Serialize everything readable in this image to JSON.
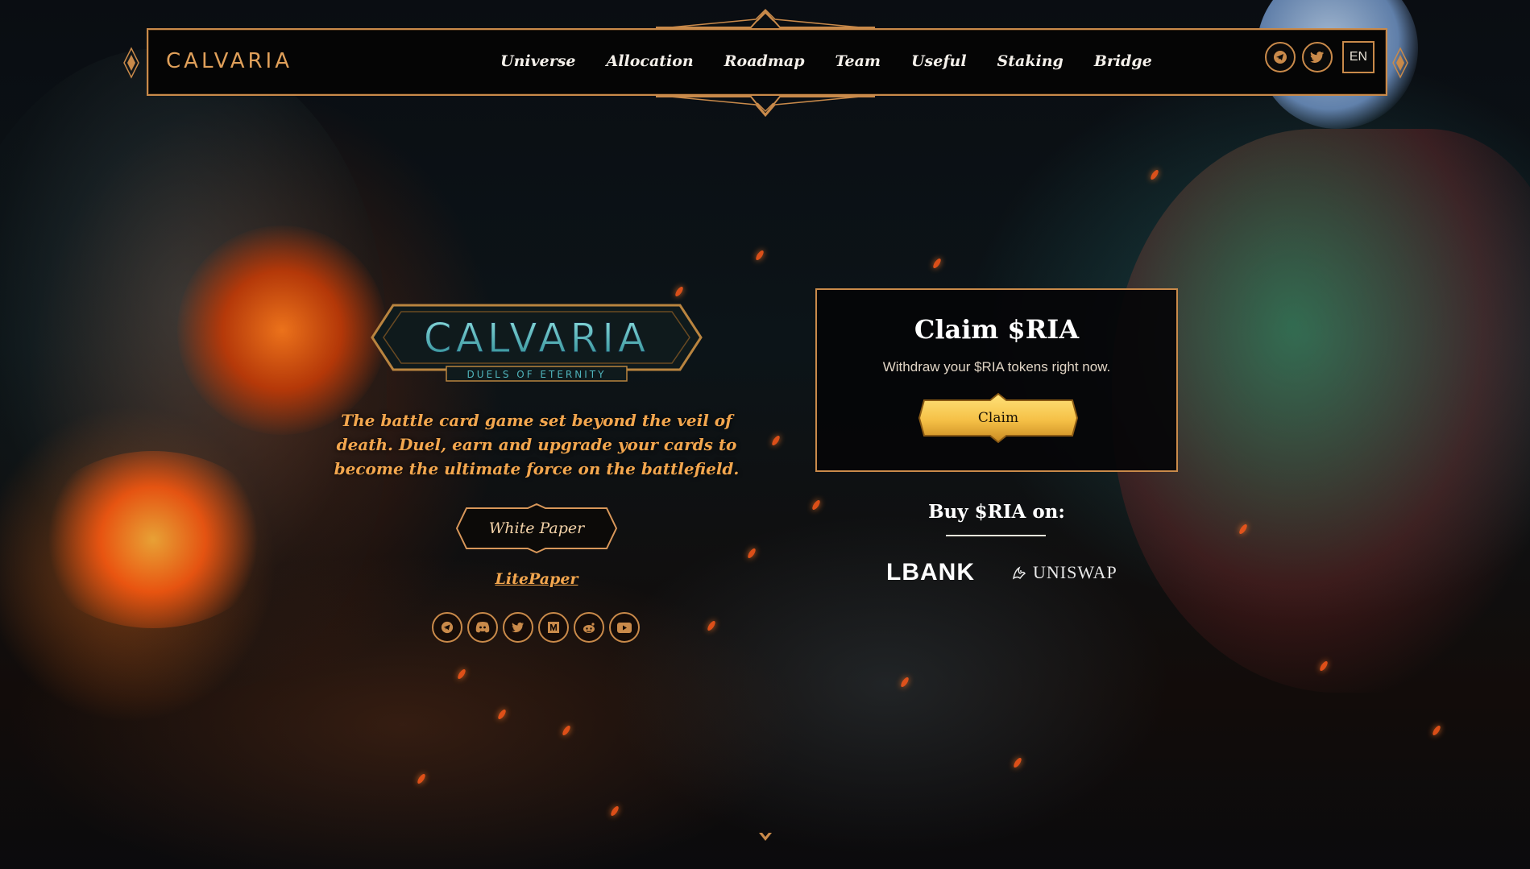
{
  "nav": {
    "brand": "CALVARIA",
    "items": [
      "Universe",
      "Allocation",
      "Roadmap",
      "Team",
      "Useful",
      "Staking",
      "Bridge"
    ],
    "icons": [
      "telegram-icon",
      "twitter-icon"
    ],
    "language": "EN"
  },
  "hero": {
    "logo_text": "CALVARIA",
    "logo_subtitle": "DUELS OF ETERNITY",
    "tagline": "The battle card game set beyond the veil of death. Duel, earn and upgrade your cards to become the ultimate force on the battlefield.",
    "whitepaper_label": "White Paper",
    "litepaper_label": "LitePaper",
    "socials": [
      "telegram-icon",
      "discord-icon",
      "twitter-icon",
      "medium-icon",
      "reddit-icon",
      "youtube-icon"
    ]
  },
  "claim": {
    "title": "Claim $RIA",
    "subtitle": "Withdraw your $RIA tokens right now.",
    "button_label": "Claim"
  },
  "buy": {
    "title": "Buy $RIA on:",
    "exchanges": [
      "LBANK",
      "UNISWAP"
    ]
  },
  "colors": {
    "accent": "#c98a4a",
    "tagline": "#f2a64e",
    "button_gold": "#f5c046"
  }
}
